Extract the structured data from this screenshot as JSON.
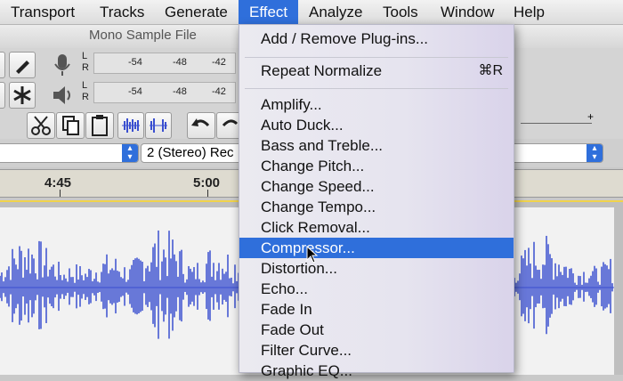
{
  "menubar": {
    "items": [
      "Transport",
      "Tracks",
      "Generate",
      "Effect",
      "Analyze",
      "Tools",
      "Window",
      "Help"
    ],
    "active": "Effect"
  },
  "window": {
    "title": "Mono Sample File"
  },
  "meters": {
    "channel_left": "L",
    "channel_right": "R",
    "ticks": [
      "-54",
      "-48",
      "-42"
    ]
  },
  "toolbar": {
    "plus": "+"
  },
  "device": {
    "channels_value": "2 (Stereo) Rec"
  },
  "timeline": {
    "ticks": [
      "4:45",
      "5:00"
    ]
  },
  "effect_menu": {
    "items": [
      {
        "label": "Add / Remove Plug-ins..."
      },
      {
        "label": "Repeat Normalize",
        "shortcut": "⌘R"
      },
      {
        "label": "Amplify..."
      },
      {
        "label": "Auto Duck..."
      },
      {
        "label": "Bass and Treble..."
      },
      {
        "label": "Change Pitch..."
      },
      {
        "label": "Change Speed..."
      },
      {
        "label": "Change Tempo..."
      },
      {
        "label": "Click Removal..."
      },
      {
        "label": "Compressor..."
      },
      {
        "label": "Distortion..."
      },
      {
        "label": "Echo..."
      },
      {
        "label": "Fade In"
      },
      {
        "label": "Fade Out"
      },
      {
        "label": "Filter Curve..."
      },
      {
        "label": "Graphic EQ..."
      }
    ],
    "highlighted": "Compressor..."
  },
  "colors": {
    "accent": "#2f6fdb",
    "waveform": "#3a4fd0",
    "timeline_bar": "#f3d651"
  }
}
